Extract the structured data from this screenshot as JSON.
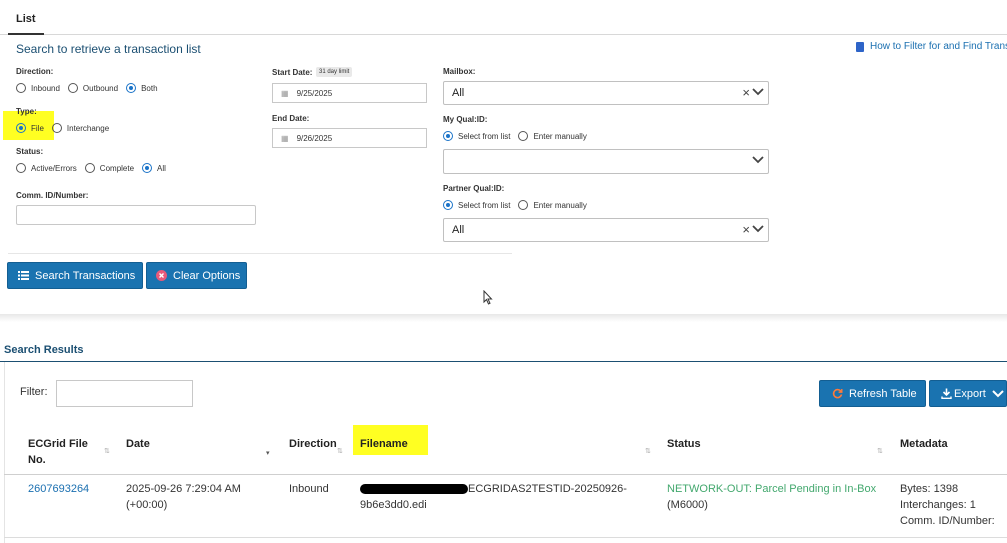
{
  "tabs": {
    "active": "List"
  },
  "search": {
    "heading": "Search to retrieve a transaction list",
    "help_link": "How to Filter for and Find Transa",
    "direction": {
      "label": "Direction:",
      "options": [
        "Inbound",
        "Outbound",
        "Both"
      ],
      "selected": "Both"
    },
    "type": {
      "label": "Type:",
      "options": [
        "File",
        "Interchange"
      ],
      "selected": "File"
    },
    "status": {
      "label": "Status:",
      "options": [
        "Active/Errors",
        "Complete",
        "All"
      ],
      "selected": "All"
    },
    "comm_id": {
      "label": "Comm. ID/Number:",
      "value": ""
    },
    "start_date": {
      "label": "Start Date:",
      "badge": "31 day limit",
      "value": "9/25/2025"
    },
    "end_date": {
      "label": "End Date:",
      "value": "9/26/2025"
    },
    "mailbox": {
      "label": "Mailbox:",
      "value": "All"
    },
    "my_qual": {
      "label": "My Qual:ID:",
      "options": [
        "Select from list",
        "Enter manually"
      ],
      "selected": "Select from list",
      "value": ""
    },
    "partner_qual": {
      "label": "Partner Qual:ID:",
      "options": [
        "Select from list",
        "Enter manually"
      ],
      "selected": "Select from list",
      "value": "All"
    },
    "search_button": "Search Transactions",
    "clear_button": "Clear Options"
  },
  "results": {
    "title": "Search Results",
    "filter_label": "Filter:",
    "filter_value": "",
    "refresh_button": "Refresh Table",
    "export_button": "Export",
    "columns": {
      "file_no_1": "ECGrid File",
      "file_no_2": "No.",
      "date": "Date",
      "direction": "Direction",
      "filename": "Filename",
      "status": "Status",
      "metadata": "Metadata"
    },
    "rows": [
      {
        "file_no": "2607693264",
        "date_1": "2025-09-26 7:29:04 AM",
        "date_2": "(+00:00)",
        "direction": "Inbound",
        "filename_1": "ECGRIDAS2TESTID-20250926-",
        "filename_2": "9b6e3dd0.edi",
        "status_1": "NETWORK-OUT: Parcel Pending in In-Box",
        "status_2": "(M6000)",
        "meta_1": "Bytes: 1398",
        "meta_2": "Interchanges: 1",
        "meta_3": "Comm. ID/Number:"
      }
    ]
  },
  "colors": {
    "accent": "#1a73b0",
    "heading": "#1b4f72",
    "highlight": "#ffff22",
    "status_ok": "#43a86e"
  }
}
